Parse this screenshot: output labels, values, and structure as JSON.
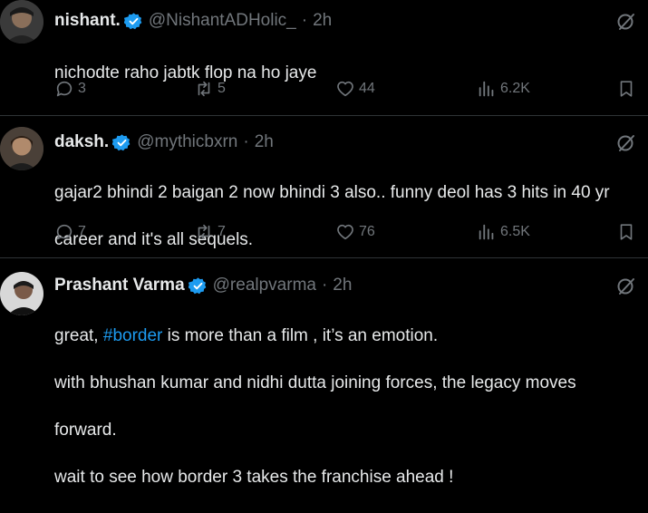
{
  "tweets": [
    {
      "name": "nishant.",
      "handle": "@NishantADHolic_",
      "separator": "·",
      "time": "2h",
      "text_lines": [
        "nichodte raho jabtk flop na ho jaye"
      ],
      "replies": "3",
      "reposts": "5",
      "likes": "44",
      "views": "6.2K"
    },
    {
      "name": "daksh.",
      "handle": "@mythicbxrn",
      "separator": "·",
      "time": "2h",
      "text_lines": [
        "gajar2 bhindi 2 baigan 2 now bhindi 3 also.. funny deol has 3 hits in 40 yr",
        "career and it's all sequels."
      ],
      "replies": "7",
      "reposts": "7",
      "likes": "76",
      "views": "6.5K"
    },
    {
      "name": "Prashant Varma",
      "handle": "@realpvarma",
      "separator": "·",
      "time": "2h",
      "line1_prefix": "great, ",
      "hashtag": "#border",
      "line1_suffix": " is more than a film , it’s an emotion.",
      "line2": "with bhushan kumar and nidhi dutta joining forces, the legacy moves",
      "line3": "forward.",
      "line4": "wait to see how border 3 takes the franchise ahead !"
    }
  ],
  "colors": {
    "background": "#000000",
    "text": "#e7e9ea",
    "muted": "#71767b",
    "accent": "#1d9bf0",
    "divider": "#2f3336"
  },
  "icons": [
    "verified-badge-icon",
    "grok-icon",
    "reply-icon",
    "repost-icon",
    "like-icon",
    "views-icon",
    "bookmark-icon"
  ]
}
